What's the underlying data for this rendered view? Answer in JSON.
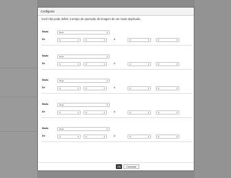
{
  "dialog": {
    "title": "Configurar",
    "message": "Você não pode definir o tempo de operação de imagem de um modo duplicado.",
    "ok_label": "OK",
    "cancel_label": "Cancelar"
  },
  "labels": {
    "mode": "Modo",
    "from": "De",
    "separator": "A"
  },
  "schedules": [
    {
      "mode": "Desl.",
      "from_h": "0",
      "from_m": "0",
      "to_h": "0",
      "to_m": "0"
    },
    {
      "mode": "Desl.",
      "from_h": "0",
      "from_m": "0",
      "to_h": "0",
      "to_m": "0"
    },
    {
      "mode": "Desl.",
      "from_h": "0",
      "from_m": "0",
      "to_h": "0",
      "to_m": "0"
    },
    {
      "mode": "Desl.",
      "from_h": "0",
      "from_m": "0",
      "to_h": "0",
      "to_m": "0"
    },
    {
      "mode": "Desl.",
      "from_h": "0",
      "from_m": "0",
      "to_h": "0",
      "to_m": "0"
    }
  ],
  "icons": {
    "dropdown": "chevron-down-icon",
    "glyph": "▾"
  }
}
